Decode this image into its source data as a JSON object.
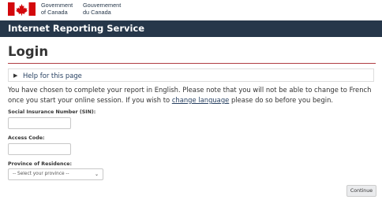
{
  "gov_header": {
    "wordmark_en": [
      "Government",
      "of Canada"
    ],
    "wordmark_fr": [
      "Gouvernement",
      "du Canada"
    ],
    "flag_color": "#d3080c"
  },
  "app_bar": {
    "title": "Internet Reporting Service",
    "background": "#26374a"
  },
  "page": {
    "title": "Login",
    "help_label": "Help for this page",
    "intro_before_link": "You have chosen to complete your report in English. Please note that you will not be able to change to French once you start your online session. If you wish to ",
    "intro_link": "change language",
    "intro_after_link": " please do so before you begin."
  },
  "form": {
    "sin_label": "Social Insurance Number (SIN):",
    "sin_value": "",
    "access_code_label": "Access Code:",
    "access_code_value": "",
    "province_label": "Province of Residence:",
    "province_selected": "-- Select your province --",
    "continue_label": "Continue"
  }
}
